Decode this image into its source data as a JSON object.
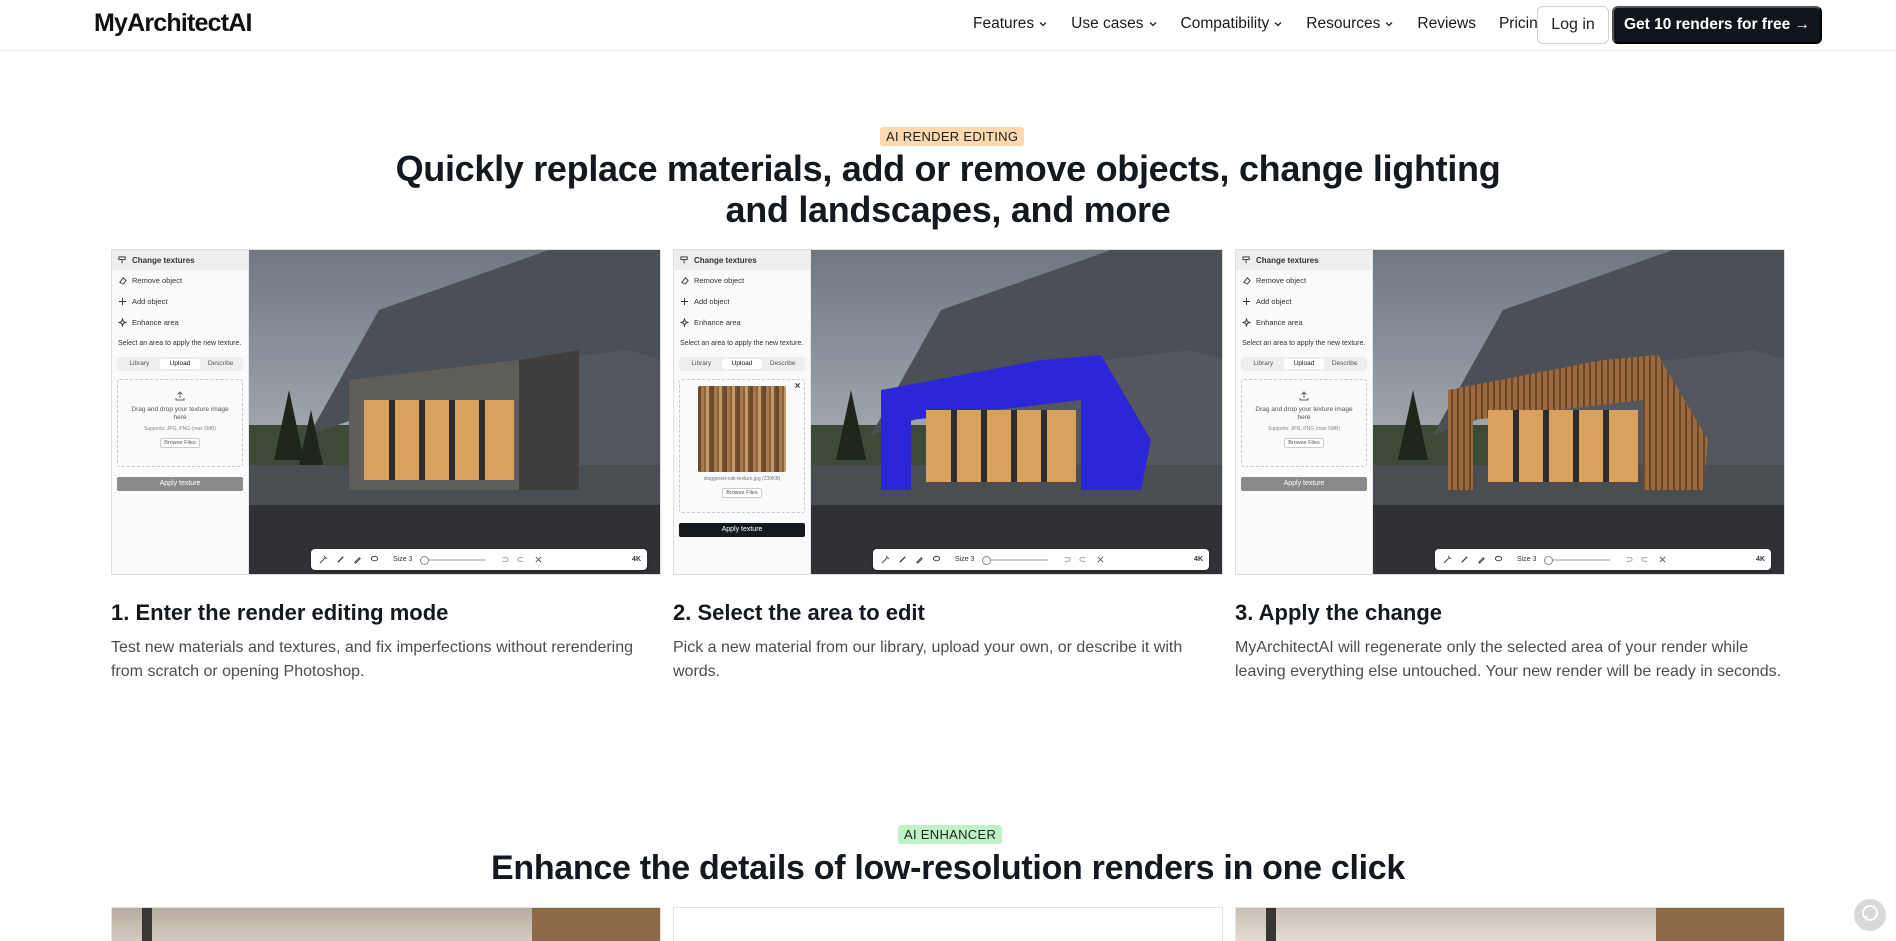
{
  "nav": {
    "logo": "MyArchitectAI",
    "items": [
      {
        "label": "Features",
        "dropdown": true
      },
      {
        "label": "Use cases",
        "dropdown": true
      },
      {
        "label": "Compatibility",
        "dropdown": true
      },
      {
        "label": "Resources",
        "dropdown": true
      },
      {
        "label": "Reviews",
        "dropdown": false
      },
      {
        "label": "Pricing",
        "dropdown": false
      }
    ],
    "login_label": "Log in",
    "cta_label": "Get 10 renders for free →"
  },
  "section_editing": {
    "badge": "AI RENDER EDITING",
    "heading": "Quickly replace materials, add or remove objects, change lighting and landscapes, and more",
    "steps": [
      {
        "title": "1. Enter the render editing mode",
        "text": "Test new materials and textures, and fix imperfections without rerendering from scratch or opening Photoshop."
      },
      {
        "title": "2. Select the area to edit",
        "text": "Pick a new material from our library, upload your own, or describe it with words."
      },
      {
        "title": "3. Apply the change",
        "text": "MyArchitectAI will regenerate only the selected area of your render while leaving everything else untouched. Your new render will be ready in seconds."
      }
    ],
    "editor": {
      "tool_active": "Change textures",
      "tools": [
        "Remove object",
        "Add object",
        "Enhance area"
      ],
      "instruction": "Select an area to apply the new texture.",
      "tabs": [
        "Library",
        "Upload",
        "Describe"
      ],
      "active_tab": "Upload",
      "drop_text": "Drag and drop your texture image here",
      "supports": "Supports: JPG, PNG (max 5MB)",
      "browse_label": "Browse Files",
      "apply_label": "Apply texture",
      "uploaded_file": "staggered-oak-texture.jpg (239KB)",
      "size_label": "Size 3",
      "resolution": "4K"
    }
  },
  "section_enhancer": {
    "badge": "AI ENHANCER",
    "heading": "Enhance the details of low-resolution renders in one click"
  },
  "colors": {
    "accent_dark": "#10151b",
    "badge_orange": "#fcd9ae",
    "badge_green": "#bff3c7",
    "selection_blue": "#2b27d8"
  }
}
